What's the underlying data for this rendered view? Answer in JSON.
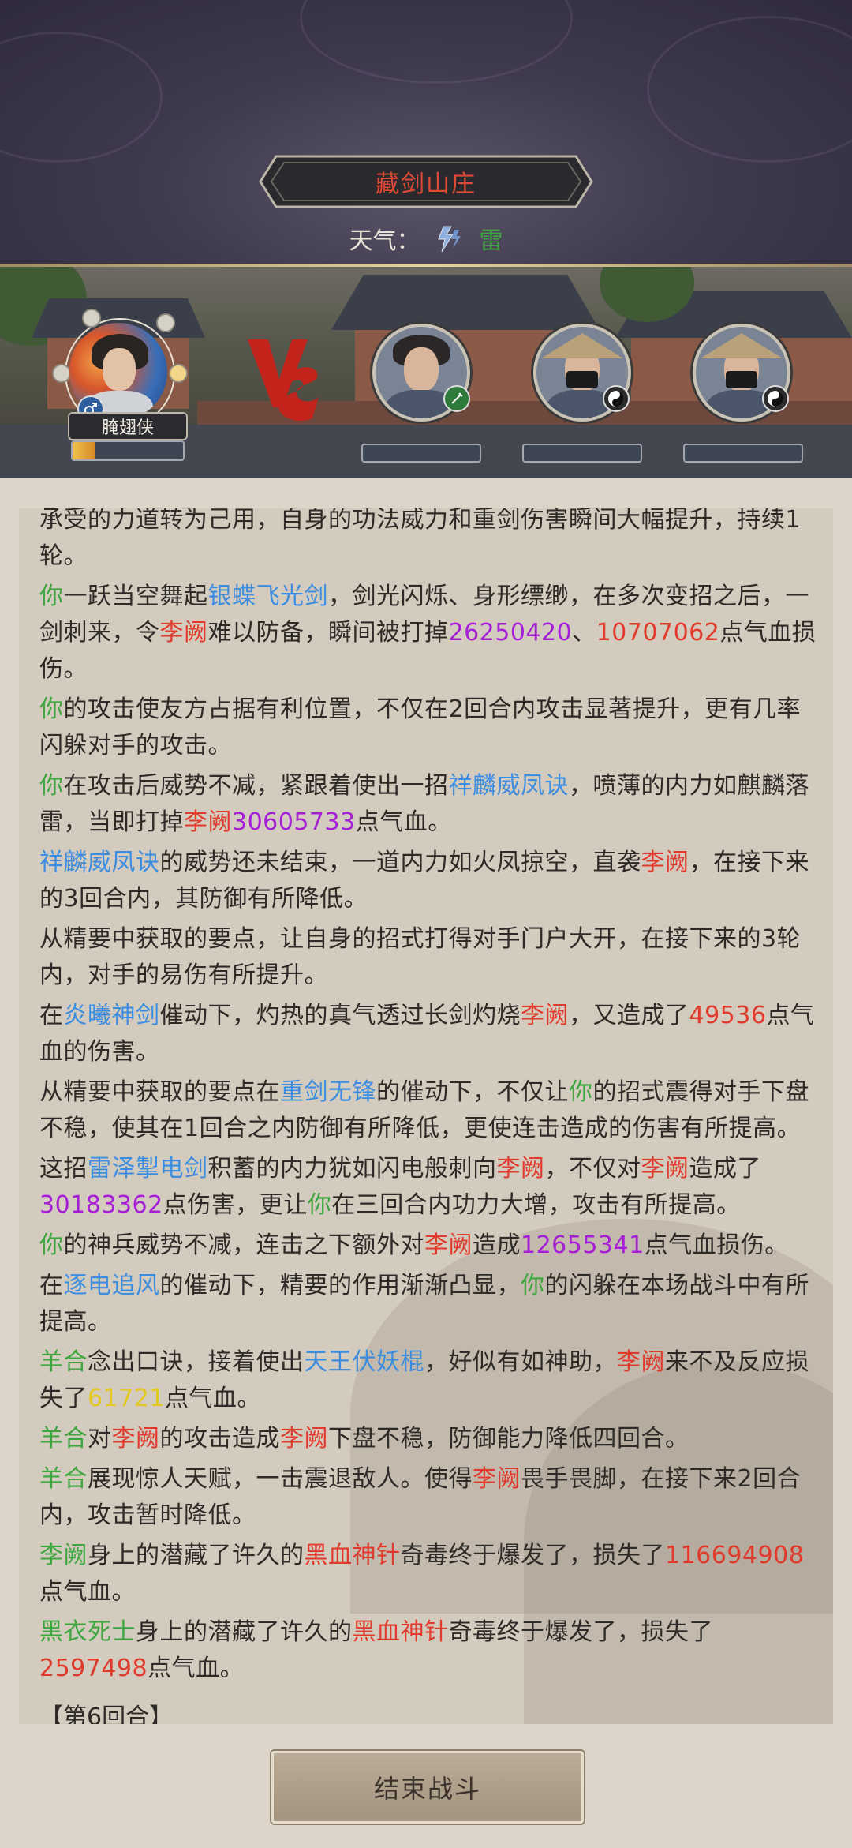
{
  "location": {
    "name": "藏剑山庄"
  },
  "weather": {
    "label": "天气：",
    "value": "雷",
    "icon": "lightning-icon"
  },
  "player": {
    "name": "腌翅侠",
    "gender_icon": "male-icon",
    "hp_fraction": 0.2
  },
  "enemies": [
    {
      "badge_icon": "sword-icon"
    },
    {
      "badge_icon": "yin-yang-icon"
    },
    {
      "badge_icon": "yin-yang-icon"
    }
  ],
  "colors": {
    "green": "#3da63f",
    "blue": "#3c8de0",
    "red": "#e03a2c",
    "purple": "#a51fd6",
    "yellow": "#e3c91f"
  },
  "log": [
    [
      [
        "k",
        "承受的力道转为己用，自身的功法威力和重剑伤害瞬间大幅提升，持续1轮。"
      ]
    ],
    [
      [
        "g",
        "你"
      ],
      [
        "k",
        "一跃当空舞起"
      ],
      [
        "b",
        "银蝶飞光剑"
      ],
      [
        "k",
        "，剑光闪烁、身形缥缈，在多次变招之后，一剑刺来，令"
      ],
      [
        "r",
        "李阙"
      ],
      [
        "k",
        "难以防备，瞬间被打掉"
      ],
      [
        "p",
        "26250420"
      ],
      [
        "k",
        "、"
      ],
      [
        "r",
        "10707062"
      ],
      [
        "k",
        "点气血损伤。"
      ]
    ],
    [
      [
        "g",
        "你"
      ],
      [
        "k",
        "的攻击使友方占据有利位置，不仅在2回合内攻击显著提升，更有几率闪躲对手的攻击。"
      ]
    ],
    [
      [
        "g",
        "你"
      ],
      [
        "k",
        "在攻击后威势不减，紧跟着使出一招"
      ],
      [
        "b",
        "祥麟威凤诀"
      ],
      [
        "k",
        "，喷薄的内力如麒麟落雷，当即打掉"
      ],
      [
        "r",
        "李阙"
      ],
      [
        "p",
        "30605733"
      ],
      [
        "k",
        "点气血。"
      ]
    ],
    [
      [
        "b",
        "祥麟威凤诀"
      ],
      [
        "k",
        "的威势还未结束，一道内力如火凤掠空，直袭"
      ],
      [
        "r",
        "李阙"
      ],
      [
        "k",
        "，在接下来的3回合内，其防御有所降低。"
      ]
    ],
    [
      [
        "k",
        "从精要中获取的要点，让自身的招式打得对手门户大开，在接下来的3轮内，对手的易伤有所提升。"
      ]
    ],
    [
      [
        "k",
        "在"
      ],
      [
        "b",
        "炎曦神剑"
      ],
      [
        "k",
        "催动下，灼热的真气透过长剑灼烧"
      ],
      [
        "r",
        "李阙"
      ],
      [
        "k",
        "，又造成了"
      ],
      [
        "r",
        "49536"
      ],
      [
        "k",
        "点气血的伤害。"
      ]
    ],
    [
      [
        "k",
        "从精要中获取的要点在"
      ],
      [
        "b",
        "重剑无锋"
      ],
      [
        "k",
        "的催动下，不仅让"
      ],
      [
        "g",
        "你"
      ],
      [
        "k",
        "的招式震得对手下盘不稳，使其在1回合之内防御有所降低，更使连击造成的伤害有所提高。"
      ]
    ],
    [
      [
        "k",
        "这招"
      ],
      [
        "b",
        "雷泽掣电剑"
      ],
      [
        "k",
        "积蓄的内力犹如闪电般刺向"
      ],
      [
        "r",
        "李阙"
      ],
      [
        "k",
        "，不仅对"
      ],
      [
        "r",
        "李阙"
      ],
      [
        "k",
        "造成了"
      ],
      [
        "p",
        "30183362"
      ],
      [
        "k",
        "点伤害，更让"
      ],
      [
        "g",
        "你"
      ],
      [
        "k",
        "在三回合内功力大增，攻击有所提高。"
      ]
    ],
    [
      [
        "g",
        "你"
      ],
      [
        "k",
        "的神兵威势不减，连击之下额外对"
      ],
      [
        "r",
        "李阙"
      ],
      [
        "k",
        "造成"
      ],
      [
        "p",
        "12655341"
      ],
      [
        "k",
        "点气血损伤。"
      ]
    ],
    [
      [
        "k",
        "在"
      ],
      [
        "b",
        "逐电追风"
      ],
      [
        "k",
        "的催动下，精要的作用渐渐凸显，"
      ],
      [
        "g",
        "你"
      ],
      [
        "k",
        "的闪躲在本场战斗中有所提高。"
      ]
    ],
    [
      [
        "g",
        "羊合"
      ],
      [
        "k",
        "念出口诀，接着使出"
      ],
      [
        "b",
        "天王伏妖棍"
      ],
      [
        "k",
        "，好似有如神助，"
      ],
      [
        "r",
        "李阙"
      ],
      [
        "k",
        "来不及反应损失了"
      ],
      [
        "y",
        "61721"
      ],
      [
        "k",
        "点气血。"
      ]
    ],
    [
      [
        "g",
        "羊合"
      ],
      [
        "k",
        "对"
      ],
      [
        "r",
        "李阙"
      ],
      [
        "k",
        "的攻击造成"
      ],
      [
        "r",
        "李阙"
      ],
      [
        "k",
        "下盘不稳，防御能力降低四回合。"
      ]
    ],
    [
      [
        "g",
        "羊合"
      ],
      [
        "k",
        "展现惊人天赋，一击震退敌人。使得"
      ],
      [
        "r",
        "李阙"
      ],
      [
        "k",
        "畏手畏脚，在接下来2回合内，攻击暂时降低。"
      ]
    ],
    [
      [
        "g",
        "李阙"
      ],
      [
        "k",
        "身上的潜藏了许久的"
      ],
      [
        "r",
        "黑血神针"
      ],
      [
        "k",
        "奇毒终于爆发了，损失了"
      ],
      [
        "r",
        "116694908"
      ],
      [
        "k",
        "点气血。"
      ]
    ],
    [
      [
        "g",
        "黑衣死士"
      ],
      [
        "k",
        "身上的潜藏了许久的"
      ],
      [
        "r",
        "黑血神针"
      ],
      [
        "k",
        "奇毒终于爆发了，损失了"
      ],
      [
        "r",
        "2597498"
      ],
      [
        "k",
        "点气血。"
      ]
    ]
  ],
  "round_marker": "【第6回合】",
  "end_button": {
    "label": "结束战斗"
  }
}
